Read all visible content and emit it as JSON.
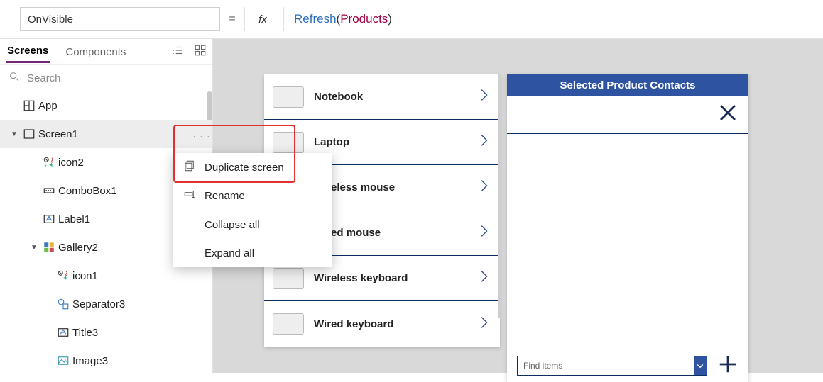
{
  "topbar": {
    "property": "OnVisible",
    "eq": "=",
    "fx": "fx",
    "formula_fn": "Refresh",
    "formula_open": "( ",
    "formula_id": "Products",
    "formula_close": " )"
  },
  "side": {
    "tabs": {
      "screens": "Screens",
      "components": "Components"
    },
    "search_placeholder": "Search",
    "nodes": {
      "app": "App",
      "screen1": "Screen1",
      "icon2": "icon2",
      "combobox1": "ComboBox1",
      "label1": "Label1",
      "gallery2": "Gallery2",
      "icon1": "icon1",
      "separator3": "Separator3",
      "title3": "Title3",
      "image3": "Image3"
    },
    "more": ". . ."
  },
  "context_menu": {
    "duplicate": "Duplicate screen",
    "rename": "Rename",
    "collapse_all": "Collapse all",
    "expand_all": "Expand all"
  },
  "gallery_items": [
    "Notebook",
    "Laptop",
    "Wireless mouse",
    "Wired mouse",
    "Wireless keyboard",
    "Wired keyboard"
  ],
  "panel": {
    "title": "Selected Product Contacts",
    "combo_placeholder": "Find items"
  }
}
